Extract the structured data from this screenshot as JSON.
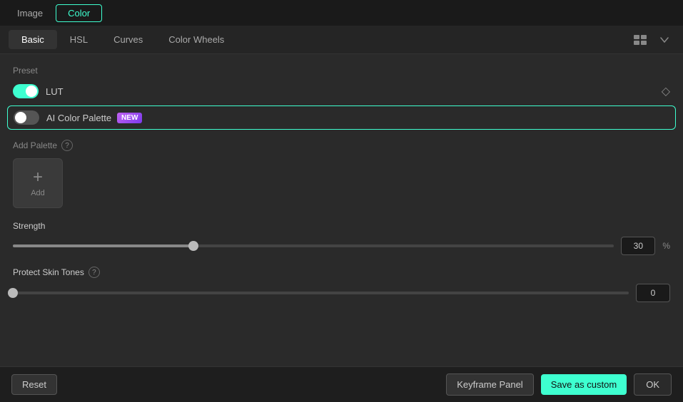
{
  "topTabs": {
    "items": [
      {
        "id": "image",
        "label": "Image",
        "active": false
      },
      {
        "id": "color",
        "label": "Color",
        "active": true
      }
    ]
  },
  "subTabs": {
    "items": [
      {
        "id": "basic",
        "label": "Basic",
        "active": true
      },
      {
        "id": "hsl",
        "label": "HSL",
        "active": false
      },
      {
        "id": "curves",
        "label": "Curves",
        "active": false
      },
      {
        "id": "colorwheels",
        "label": "Color Wheels",
        "active": false
      }
    ]
  },
  "preset": {
    "label": "Preset",
    "lut": {
      "label": "LUT",
      "enabled": true
    },
    "aiColorPalette": {
      "label": "AI Color Palette",
      "badge": "NEW",
      "enabled": false
    }
  },
  "addPalette": {
    "label": "Add Palette",
    "addButtonLabel": "Add"
  },
  "strength": {
    "label": "Strength",
    "value": "30",
    "unit": "%",
    "percent": 30
  },
  "protectSkinTones": {
    "label": "Protect Skin Tones",
    "value": "0"
  },
  "bottomBar": {
    "resetLabel": "Reset",
    "keyframeLabel": "Keyframe Panel",
    "saveCustomLabel": "Save as custom",
    "okLabel": "OK"
  }
}
